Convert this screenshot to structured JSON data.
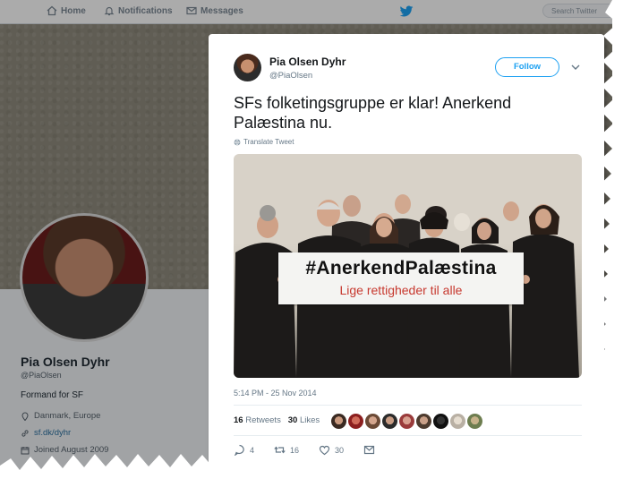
{
  "topnav": {
    "home_label": "Home",
    "notifications_label": "Notifications",
    "messages_label": "Messages",
    "search_placeholder": "Search Twitter"
  },
  "profile": {
    "name": "Pia Olsen Dyhr",
    "handle": "@PiaOlsen",
    "bio": "Formand for SF",
    "location": "Danmark, Europe",
    "website": "sf.dk/dyhr",
    "joined": "Joined August 2009"
  },
  "tweet": {
    "author_name": "Pia Olsen Dyhr",
    "author_handle": "@PiaOlsen",
    "follow_label": "Follow",
    "text": "SFs folketingsgruppe er klar! Anerkend Palæstina nu.",
    "translate_label": "Translate Tweet",
    "photo": {
      "banner_hashtag": "#AnerkendPalæstina",
      "banner_subtitle": "Lige rettigheder til alle"
    },
    "timestamp": "5:14 PM - 25 Nov 2014",
    "retweets_count": "16",
    "retweets_label": "Retweets",
    "likes_count": "30",
    "likes_label": "Likes",
    "reply_count": "4",
    "retweet_action_count": "16",
    "like_action_count": "30"
  },
  "colors": {
    "accent": "#1da1f2",
    "banner_red": "#c7392f"
  },
  "icons": [
    "home-icon",
    "bell-icon",
    "envelope-icon",
    "twitter-bird-icon",
    "globe-icon",
    "reply-icon",
    "retweet-icon",
    "heart-icon",
    "dm-icon",
    "chevron-down-icon",
    "location-icon",
    "link-icon",
    "calendar-icon"
  ]
}
